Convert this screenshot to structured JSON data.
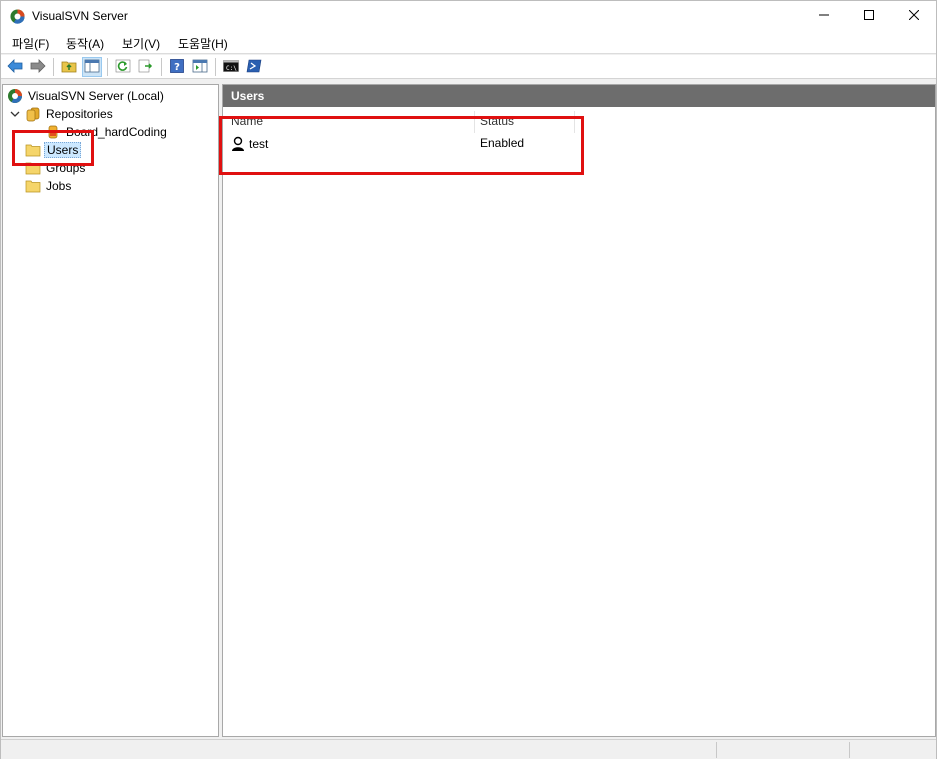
{
  "window": {
    "title": "VisualSVN Server",
    "logo_icon": "visualsvn-logo-icon",
    "controls": [
      "minimize-icon",
      "maximize-icon",
      "close-icon"
    ]
  },
  "menu": {
    "items": [
      {
        "label": "파일(F)"
      },
      {
        "label": "동작(A)"
      },
      {
        "label": "보기(V)"
      },
      {
        "label": "도움말(H)"
      }
    ]
  },
  "toolbar": {
    "buttons": [
      "back-arrow-icon",
      "forward-arrow-icon",
      "up-folder-icon",
      "show-hide-tree-icon",
      "refresh-icon",
      "export-list-icon",
      "help-icon",
      "properties-pane-icon",
      "command-prompt-icon",
      "powershell-icon"
    ]
  },
  "tree": {
    "root": {
      "label": "VisualSVN Server (Local)"
    },
    "repositories": {
      "label": "Repositories"
    },
    "repo_item": {
      "label": "Board_hardCoding"
    },
    "users": {
      "label": "Users"
    },
    "groups": {
      "label": "Groups"
    },
    "jobs": {
      "label": "Jobs"
    }
  },
  "content": {
    "header": "Users",
    "columns": [
      {
        "label": "Name"
      },
      {
        "label": "Status"
      }
    ],
    "rows": [
      {
        "name": "test",
        "status": "Enabled",
        "icon": "user-icon"
      }
    ]
  },
  "colors": {
    "header_bg": "#6d6d6d",
    "annotation": "#e01010",
    "selection": "#cce8ff"
  }
}
